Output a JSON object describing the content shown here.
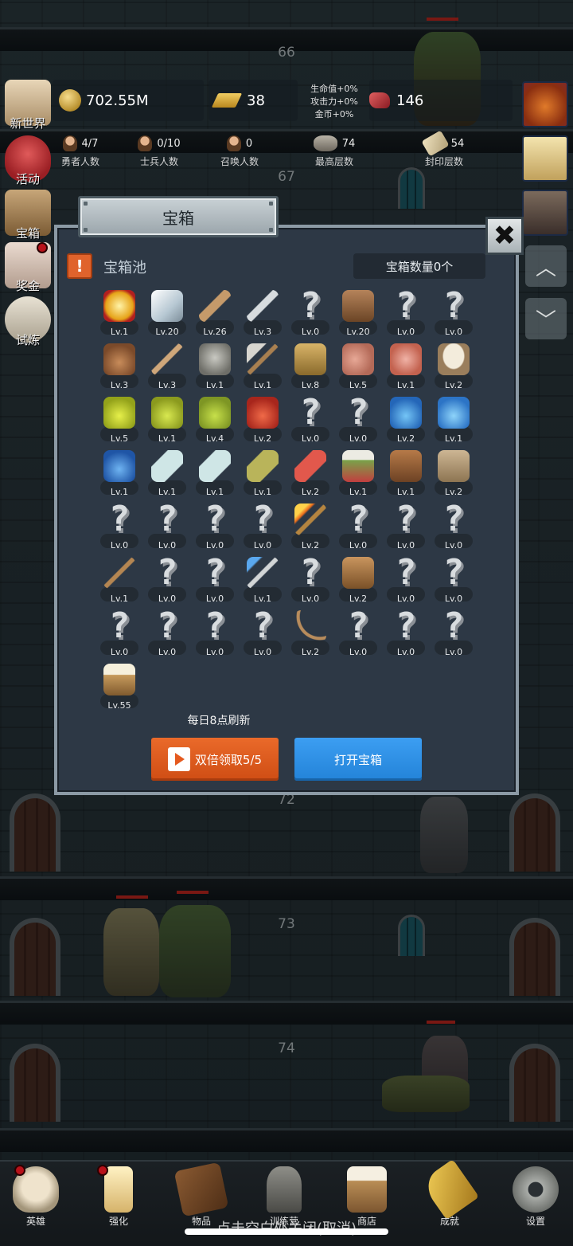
{
  "floors": [
    "66",
    "67",
    "72",
    "73",
    "74"
  ],
  "hud": {
    "gold": "702.55M",
    "bars": "38",
    "buffs": [
      "生命值+0%",
      "攻击力+0%",
      "金币+0%"
    ],
    "gems": "146",
    "stats": [
      {
        "value": "4/7",
        "label": "勇者人数"
      },
      {
        "value": "0/10",
        "label": "士兵人数"
      },
      {
        "value": "0",
        "label": "召唤人数"
      },
      {
        "value": "74",
        "label": "最高层数"
      },
      {
        "value": "54",
        "label": "封印层数"
      }
    ]
  },
  "side_menu": [
    "新世界",
    "活动",
    "宝箱",
    "奖金",
    "试炼"
  ],
  "modal": {
    "title": "宝箱",
    "close": "✖",
    "pool_icon": "!",
    "pool_label": "宝箱池",
    "chest_count": "宝箱数量0个",
    "refresh_note": "每日8点刷新",
    "double_button": "双倍领取5/5",
    "open_button": "打开宝箱",
    "items": [
      {
        "icon": "crown-icon",
        "lv": "Lv.1"
      },
      {
        "icon": "diamond-icon",
        "lv": "Lv.20"
      },
      {
        "icon": "wooden-sword-icon",
        "lv": "Lv.26"
      },
      {
        "icon": "iron-sword-icon",
        "lv": "Lv.3"
      },
      {
        "icon": "unknown-icon",
        "lv": "Lv.0"
      },
      {
        "icon": "leather-armor-icon",
        "lv": "Lv.20"
      },
      {
        "icon": "unknown-icon",
        "lv": "Lv.0"
      },
      {
        "icon": "unknown-icon",
        "lv": "Lv.0"
      },
      {
        "icon": "leather-helmet-icon",
        "lv": "Lv.3"
      },
      {
        "icon": "dagger-icon",
        "lv": "Lv.3"
      },
      {
        "icon": "iron-helmet-icon",
        "lv": "Lv.1"
      },
      {
        "icon": "hammer-icon",
        "lv": "Lv.1"
      },
      {
        "icon": "knight-helmet-icon",
        "lv": "Lv.8"
      },
      {
        "icon": "ham-icon",
        "lv": "Lv.5"
      },
      {
        "icon": "steak-icon",
        "lv": "Lv.1"
      },
      {
        "icon": "rice-bowl-icon",
        "lv": "Lv.2"
      },
      {
        "icon": "yellow-potion-icon",
        "lv": "Lv.5"
      },
      {
        "icon": "yellow-flask-icon",
        "lv": "Lv.1"
      },
      {
        "icon": "green-potion-icon",
        "lv": "Lv.4"
      },
      {
        "icon": "red-potion-icon",
        "lv": "Lv.2"
      },
      {
        "icon": "unknown-icon",
        "lv": "Lv.0"
      },
      {
        "icon": "unknown-icon",
        "lv": "Lv.0"
      },
      {
        "icon": "blue-potion-icon",
        "lv": "Lv.2"
      },
      {
        "icon": "blue-flask-icon",
        "lv": "Lv.1"
      },
      {
        "icon": "mana-potion-icon",
        "lv": "Lv.1"
      },
      {
        "icon": "pale-bottle-icon",
        "lv": "Lv.1"
      },
      {
        "icon": "pale-bottle-icon",
        "lv": "Lv.1"
      },
      {
        "icon": "olive-bottle-icon",
        "lv": "Lv.1"
      },
      {
        "icon": "red-vial-icon",
        "lv": "Lv.2"
      },
      {
        "icon": "winged-boots-icon",
        "lv": "Lv.1"
      },
      {
        "icon": "leather-boots-icon",
        "lv": "Lv.1"
      },
      {
        "icon": "cloth-boots-icon",
        "lv": "Lv.2"
      },
      {
        "icon": "unknown-icon",
        "lv": "Lv.0"
      },
      {
        "icon": "unknown-icon",
        "lv": "Lv.0"
      },
      {
        "icon": "unknown-icon",
        "lv": "Lv.0"
      },
      {
        "icon": "unknown-icon",
        "lv": "Lv.0"
      },
      {
        "icon": "torch-icon",
        "lv": "Lv.2"
      },
      {
        "icon": "unknown-icon",
        "lv": "Lv.0"
      },
      {
        "icon": "unknown-icon",
        "lv": "Lv.0"
      },
      {
        "icon": "unknown-icon",
        "lv": "Lv.0"
      },
      {
        "icon": "wooden-staff-icon",
        "lv": "Lv.1"
      },
      {
        "icon": "unknown-icon",
        "lv": "Lv.0"
      },
      {
        "icon": "unknown-icon",
        "lv": "Lv.0"
      },
      {
        "icon": "blue-wand-icon",
        "lv": "Lv.1"
      },
      {
        "icon": "unknown-icon",
        "lv": "Lv.0"
      },
      {
        "icon": "backpack-icon",
        "lv": "Lv.2"
      },
      {
        "icon": "unknown-icon",
        "lv": "Lv.0"
      },
      {
        "icon": "unknown-icon",
        "lv": "Lv.0"
      },
      {
        "icon": "unknown-icon",
        "lv": "Lv.0"
      },
      {
        "icon": "unknown-icon",
        "lv": "Lv.0"
      },
      {
        "icon": "unknown-icon",
        "lv": "Lv.0"
      },
      {
        "icon": "unknown-icon",
        "lv": "Lv.0"
      },
      {
        "icon": "bow-icon",
        "lv": "Lv.2"
      },
      {
        "icon": "unknown-icon",
        "lv": "Lv.0"
      },
      {
        "icon": "unknown-icon",
        "lv": "Lv.0"
      },
      {
        "icon": "unknown-icon",
        "lv": "Lv.0"
      },
      {
        "icon": "beer-mug-icon",
        "lv": "Lv.55"
      }
    ]
  },
  "bottom_nav": [
    "英雄",
    "强化",
    "物品",
    "训练营",
    "商店",
    "成就",
    "设置"
  ],
  "close_tip": "点击空白处关闭(取消)",
  "colors": {
    "modal_bg": "#2d3845",
    "orange_button": "#e0632c",
    "blue_button": "#2f92e8",
    "question_mark": "#d8dcdf"
  }
}
